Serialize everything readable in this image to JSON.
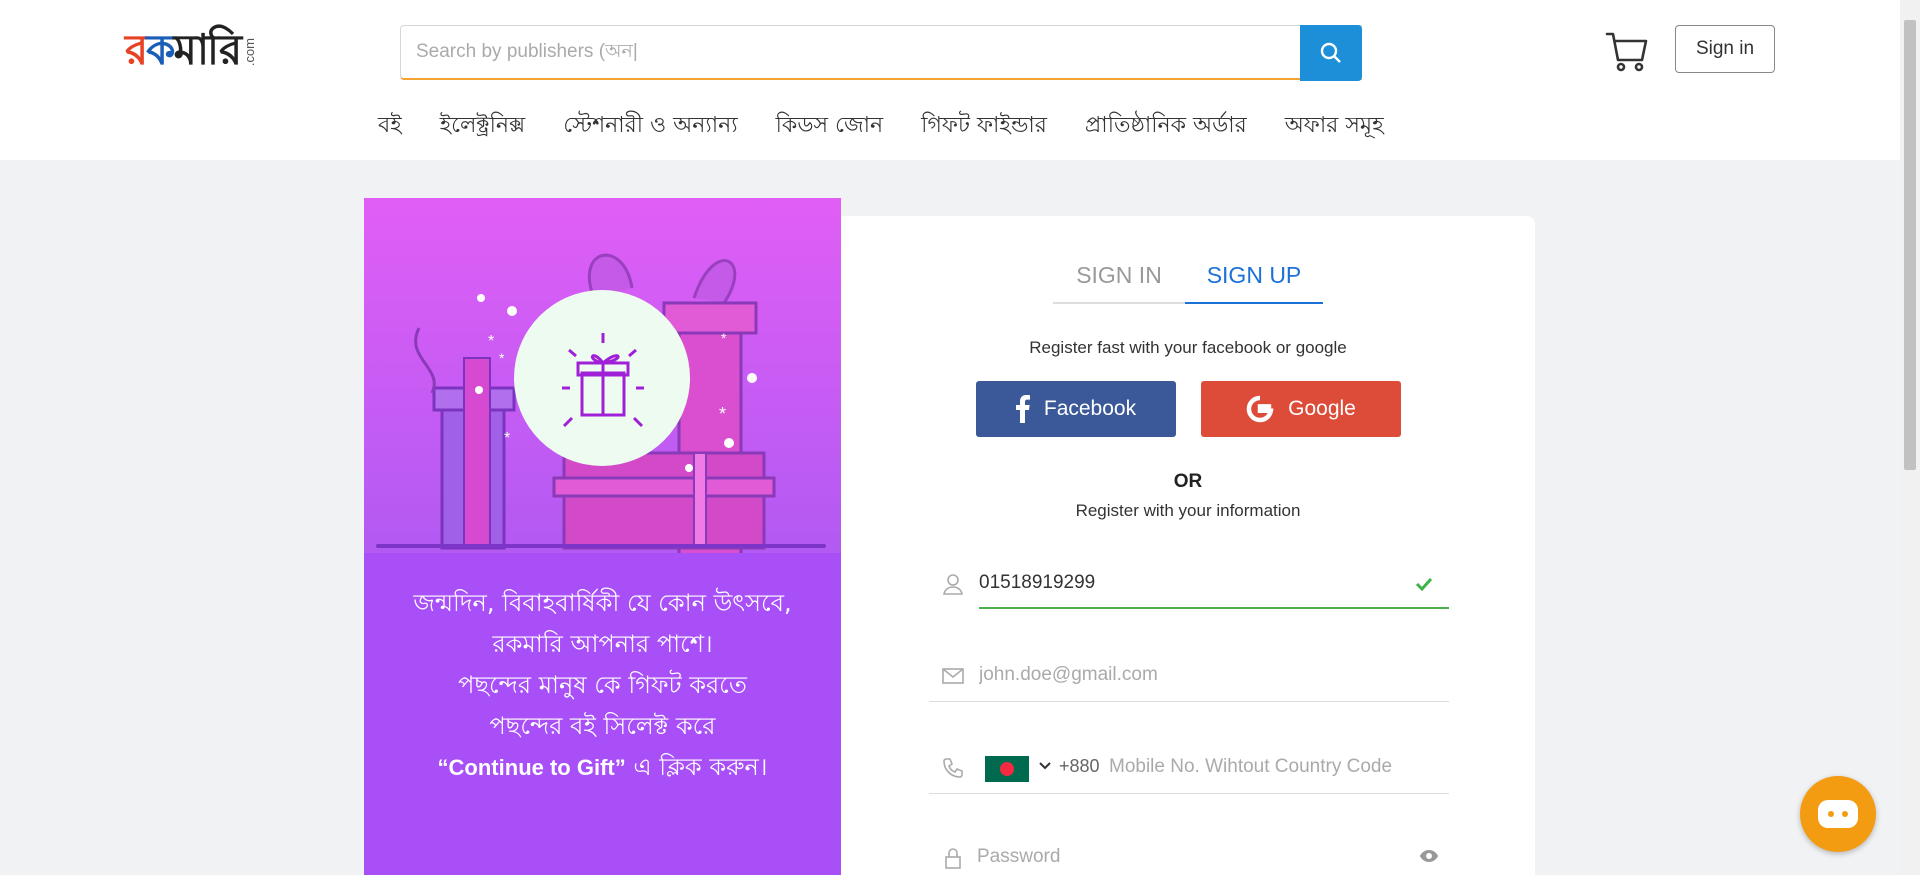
{
  "header": {
    "logo": {
      "main": [
        "র",
        "ক",
        "মারি"
      ],
      "suffix": ".com"
    },
    "search": {
      "placeholder": "Search by publishers (অন|"
    },
    "signin_label": "Sign in",
    "nav": [
      "বই",
      "ইলেক্ট্রনিক্স",
      "স্টেশনারী ও অন্যান্য",
      "কিডস জোন",
      "গিফট ফাইন্ডার",
      "প্রাতিষ্ঠানিক অর্ডার",
      "অফার সমূহ"
    ]
  },
  "promo": {
    "lines": [
      "জন্মদিন, বিবাহবার্ষিকী যে কোন উৎসবে,",
      "রকমারি আপনার পাশে।",
      "পছন্দের মানুষ কে গিফট করতে",
      "পছন্দের বই সিলেক্ট করে"
    ],
    "last_line_quote": "“Continue to Gift”",
    "last_line_rest": " এ ক্লিক করুন।"
  },
  "auth": {
    "tabs": [
      {
        "label": "SIGN IN",
        "active": false
      },
      {
        "label": "SIGN UP",
        "active": true
      }
    ],
    "social_prompt": "Register fast with your facebook or google",
    "facebook_label": "Facebook",
    "google_label": "Google",
    "or_label": "OR",
    "info_prompt": "Register with your information",
    "fields": {
      "username": {
        "value": "01518919299",
        "valid": true
      },
      "email": {
        "placeholder": "john.doe@gmail.com",
        "value": ""
      },
      "mobile": {
        "country_code": "+880",
        "placeholder": "Mobile No. Wihtout Country Code",
        "value": ""
      },
      "password": {
        "placeholder": "Password",
        "value": ""
      }
    }
  },
  "colors": {
    "search_button": "#1d8fd9",
    "facebook": "#3b5998",
    "google": "#dd4b39",
    "active_tab": "#1b71d6",
    "valid": "#4cae4c",
    "chat": "#f39c12"
  },
  "icons": [
    "search-icon",
    "cart-icon",
    "facebook-icon",
    "google-icon",
    "user-icon",
    "check-icon",
    "mail-icon",
    "phone-icon",
    "chevron-down-icon",
    "lock-icon",
    "eye-icon",
    "chat-icon"
  ]
}
